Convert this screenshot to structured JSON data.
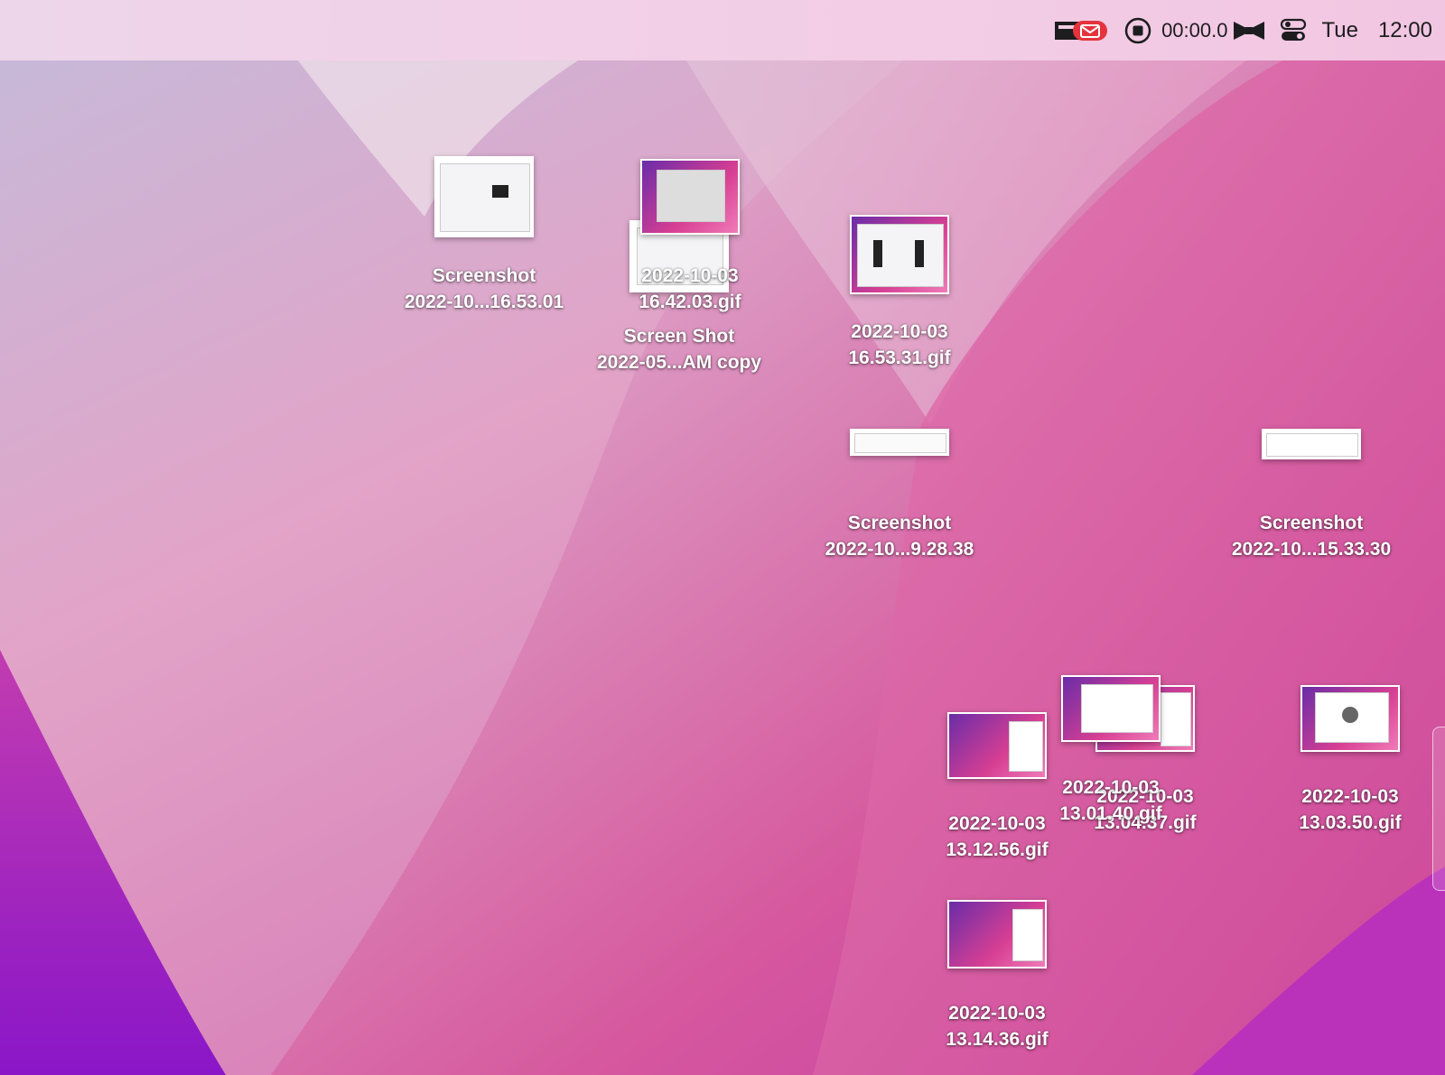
{
  "menubar": {
    "timer": "00:00.0",
    "day": "Tue",
    "time": "12:00",
    "icons": [
      "mail-badge-icon",
      "record-stop-icon",
      "bow-tie-icon",
      "control-center-icon"
    ],
    "mail_badge_color": "#e5333d"
  },
  "desktop": {
    "files": [
      {
        "line1": "Screenshot",
        "line2": "2022-10...16.53.01"
      },
      {
        "line1": "2022-10-03",
        "line2": "16.42.03.gif"
      },
      {
        "line1": "Screen Shot",
        "line2": "2022-05...AM copy"
      },
      {
        "line1": "2022-10-03",
        "line2": "16.53.31.gif"
      },
      {
        "line1": "Screenshot",
        "line2": "2022-10...9.28.38"
      },
      {
        "line1": "Screenshot",
        "line2": "2022-10...15.33.30"
      },
      {
        "line1": "2022-10-03",
        "line2": "13.12.56.gif"
      },
      {
        "line1": "2022-10-03",
        "line2": "13.01.40.gif"
      },
      {
        "line1": "2022-10-03",
        "line2": "13.04.37.gif"
      },
      {
        "line1": "2022-10-03",
        "line2": "13.03.50.gif"
      },
      {
        "line1": "2022-10-03",
        "line2": "13.14.36.gif"
      }
    ]
  }
}
